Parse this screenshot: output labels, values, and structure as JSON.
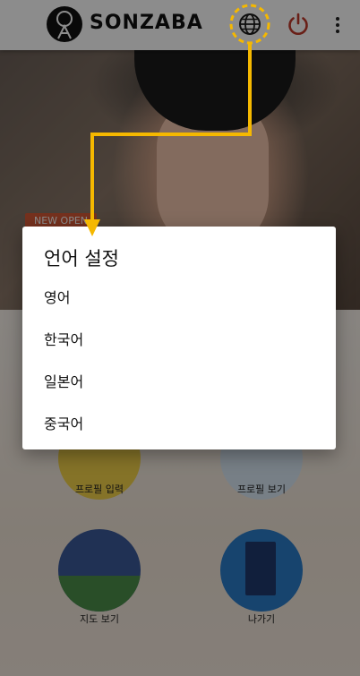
{
  "app": {
    "name": "SONZABA",
    "hero_badge": "NEW OPEN"
  },
  "menu": {
    "items": [
      {
        "label": "프로필 입력",
        "icon": "profile-input-icon"
      },
      {
        "label": "프로필 보기",
        "icon": "profile-view-icon"
      },
      {
        "label": "지도 보기",
        "icon": "map-icon"
      },
      {
        "label": "나가기",
        "icon": "exit-icon"
      }
    ]
  },
  "language_dialog": {
    "title": "언어 설정",
    "options": [
      "영어",
      "한국어",
      "일본어",
      "중국어"
    ]
  },
  "colors": {
    "annotation": "#f5b800",
    "power_icon": "#c0392b",
    "overlay": "rgba(0,0,0,0.45)"
  }
}
